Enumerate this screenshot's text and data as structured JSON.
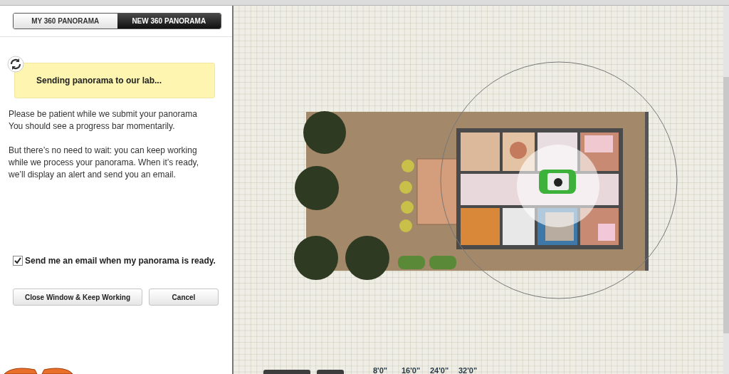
{
  "tabs": [
    {
      "label": "MY 360 PANORAMA",
      "selected": false
    },
    {
      "label": "NEW 360 PANORAMA",
      "selected": true
    }
  ],
  "status": {
    "message": "Sending panorama to our lab..."
  },
  "paragraphs": [
    [
      "Please be patient while we submit your panorama",
      "You should see a progress bar momentarily."
    ],
    [
      "But there’s no need to wait: you can keep working while we process your panorama. When it’s ready, we’ll display an alert and send you an email."
    ]
  ],
  "email_option": {
    "label": "Send me an email when my panorama is ready.",
    "checked": true
  },
  "buttons": [
    "Close Window & Keep Working",
    "Cancel"
  ],
  "ruler": {
    "labels": [
      "8'0\"",
      "16'0\"",
      "24'0\"",
      "32'0\""
    ]
  }
}
